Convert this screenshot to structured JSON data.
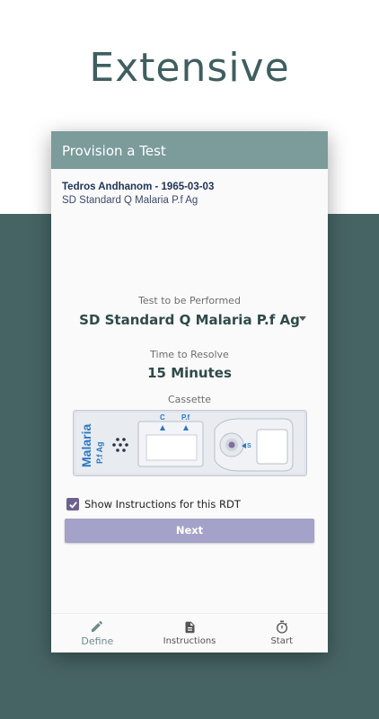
{
  "headline": "Extensive",
  "app_bar": {
    "title": "Provision a Test"
  },
  "patient": {
    "name_dob": "Tedros Andhanom - 1965-03-03",
    "test_name": "SD Standard Q Malaria P.f Ag"
  },
  "form": {
    "test_label": "Test to be Performed",
    "test_value": "SD Standard Q Malaria P.f Ag",
    "time_label": "Time to Resolve",
    "time_value": "15 Minutes",
    "cassette_label": "Cassette",
    "cassette": {
      "brand_line1": "Malaria",
      "brand_line2": "P.f Ag",
      "marker_c": "C",
      "marker_pf": "P.f",
      "marker_s": "S"
    },
    "show_instructions": {
      "label": "Show Instructions for this RDT",
      "checked": true
    },
    "next_label": "Next"
  },
  "bottom_nav": [
    {
      "label": "Define",
      "icon": "pencil-icon",
      "active": true
    },
    {
      "label": "Instructions",
      "icon": "document-icon",
      "active": false
    },
    {
      "label": "Start",
      "icon": "stopwatch-icon",
      "active": false
    }
  ],
  "colors": {
    "brand_teal": "#476465",
    "app_bar": "#7c9b9b",
    "button": "#a4a2c8",
    "checkbox": "#6d6190"
  }
}
